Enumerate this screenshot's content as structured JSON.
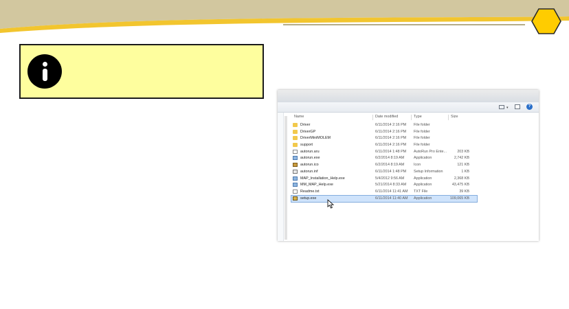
{
  "explorer": {
    "columns": {
      "name": "Name",
      "date": "Date modified",
      "type": "Type",
      "size": "Size"
    },
    "help_label": "?",
    "view_dropdown_glyph": "▾",
    "files": [
      {
        "name": "Driver",
        "date": "6/11/2014 2:16 PM",
        "type": "File folder",
        "size": "",
        "icon": "folder-icon"
      },
      {
        "name": "DriverGP",
        "date": "6/11/2014 2:16 PM",
        "type": "File folder",
        "size": "",
        "icon": "folder-icon"
      },
      {
        "name": "DriverMiniMOLEM",
        "date": "6/11/2014 2:16 PM",
        "type": "File folder",
        "size": "",
        "icon": "folder-icon"
      },
      {
        "name": "support",
        "date": "6/11/2014 2:16 PM",
        "type": "File folder",
        "size": "",
        "icon": "folder-icon"
      },
      {
        "name": "autorun.aru",
        "date": "6/11/2014 1:48 PM",
        "type": "AutoRun Pro Ente...",
        "size": "203 KB",
        "icon": "file-icon"
      },
      {
        "name": "autorun.exe",
        "date": "6/2/2014 8:19 AM",
        "type": "Application",
        "size": "2,742 KB",
        "icon": "application-icon"
      },
      {
        "name": "autorun.ico",
        "date": "6/2/2014 8:19 AM",
        "type": "Icon",
        "size": "121 KB",
        "icon": "image-icon"
      },
      {
        "name": "autorun.inf",
        "date": "6/11/2014 1:48 PM",
        "type": "Setup Information",
        "size": "1 KB",
        "icon": "config-icon"
      },
      {
        "name": "MAP_Installation_Help.exe",
        "date": "5/4/2012 9:56 AM",
        "type": "Application",
        "size": "2,368 KB",
        "icon": "application-icon"
      },
      {
        "name": "MM_MAP_Help.exe",
        "date": "5/21/2014 8:33 AM",
        "type": "Application",
        "size": "43,475 KB",
        "icon": "application-icon"
      },
      {
        "name": "Readme.txt",
        "date": "6/11/2014 11:41 AM",
        "type": "TXT File",
        "size": "39 KB",
        "icon": "file-icon"
      },
      {
        "name": "setup.exe",
        "date": "6/11/2014 11:40 AM",
        "type": "Application",
        "size": "109,065 KB",
        "icon": "setup-icon",
        "selected": true
      }
    ]
  },
  "colors": {
    "header_band": "#d2c79f",
    "header_accent": "#f2c52e",
    "hexagon": "#ffcc00",
    "callout_bg": "#fefe9e",
    "selection": "#cfe3fb"
  }
}
